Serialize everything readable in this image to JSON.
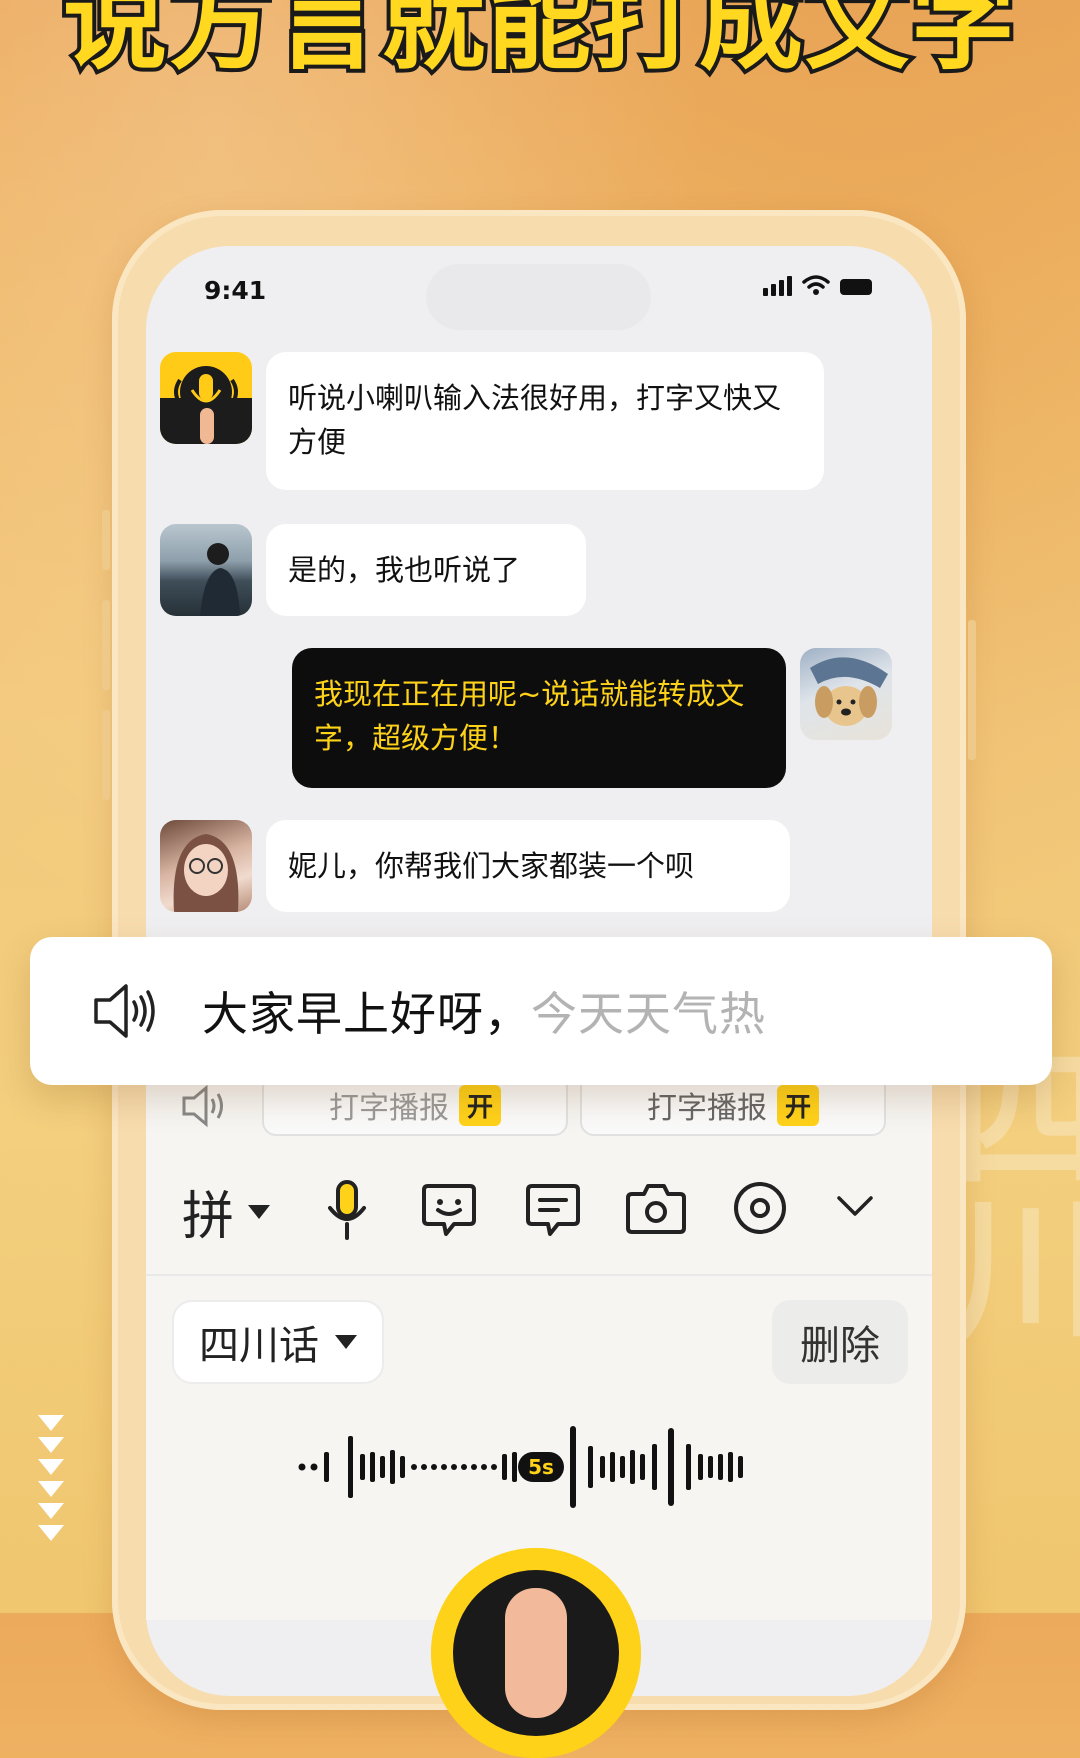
{
  "headline": "说方言就能打成文字",
  "watermark": "四川",
  "status_bar": {
    "time": "9:41"
  },
  "chat": {
    "messages": [
      {
        "sender": "app",
        "text": "听说小喇叭输入法很好用，打字又快又方便"
      },
      {
        "sender": "friend-1",
        "text": "是的，我也听说了"
      },
      {
        "sender": "me",
        "text": "我现在正在用呢~说话就能转成文字，超级方便！"
      },
      {
        "sender": "friend-2",
        "text": "妮儿，你帮我们大家都装一个呗"
      }
    ]
  },
  "transcription": {
    "confirmed_text": "大家早上好呀，",
    "pending_text": "今天天气热"
  },
  "keyboard": {
    "chips": [
      {
        "label": "打字播报",
        "tag": "开"
      },
      {
        "label": "打字播报",
        "tag": "开"
      }
    ],
    "toolbar": {
      "input_mode": "拼",
      "icons": [
        "microphone-icon",
        "emoji-icon",
        "message-icon",
        "camera-icon",
        "settings-icon",
        "chevron-down-icon"
      ]
    },
    "dialect": "四川话",
    "delete_label": "删除",
    "duration": "5s"
  },
  "colors": {
    "accent": "#ffd21a",
    "dark_bubble": "#0d0d0d",
    "background": "#f0b868"
  }
}
